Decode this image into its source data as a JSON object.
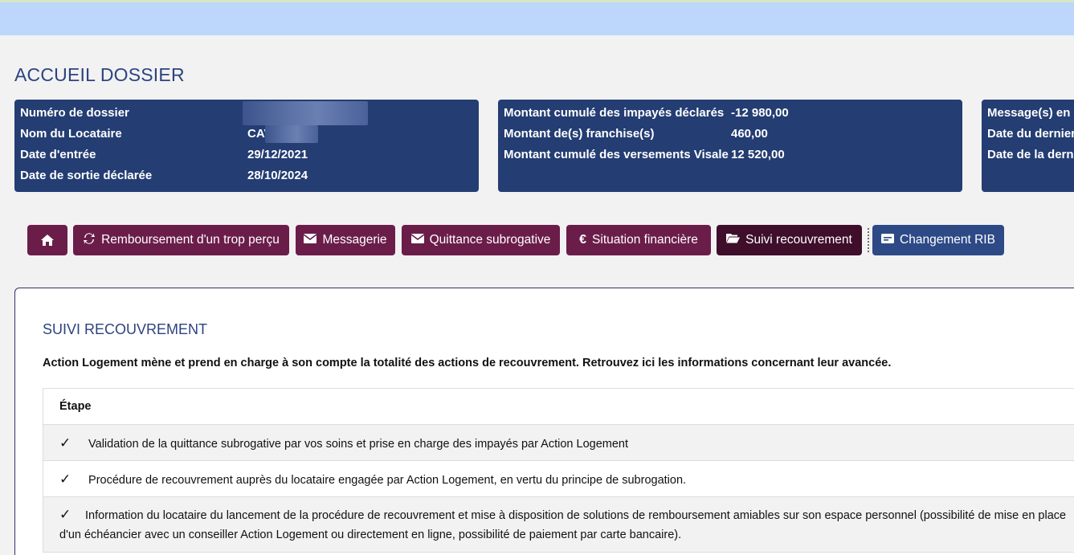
{
  "page": {
    "title": "ACCUEIL DOSSIER"
  },
  "dossier": {
    "rows": [
      {
        "label": "Numéro de dossier",
        "value": ""
      },
      {
        "label": "Nom du Locataire",
        "value": "CAV"
      },
      {
        "label": "Date d'entrée",
        "value": "29/12/2021"
      },
      {
        "label": "Date de sortie déclarée",
        "value": "28/10/2024"
      }
    ]
  },
  "montants": {
    "rows": [
      {
        "label": "Montant cumulé des impayés déclarés",
        "value": "-12 980,00"
      },
      {
        "label": "Montant de(s) franchise(s)",
        "value": "460,00"
      },
      {
        "label": "Montant cumulé des versements Visale",
        "value": "12 520,00"
      }
    ]
  },
  "messages": {
    "rows": [
      {
        "label": "Message(s) en a"
      },
      {
        "label": "Date du dernier"
      },
      {
        "label": "Date de la derni"
      }
    ]
  },
  "nav": {
    "home_icon": "home-icon",
    "buttons": [
      {
        "label": "Remboursement d'un trop perçu",
        "icon": "refresh-icon"
      },
      {
        "label": "Messagerie",
        "icon": "envelope-icon"
      },
      {
        "label": "Quittance subrogative",
        "icon": "envelope-icon"
      },
      {
        "label": "Situation financière",
        "icon": "euro-icon"
      },
      {
        "label": "Suivi recouvrement",
        "icon": "folder-open-icon"
      },
      {
        "label": "Changement RIB",
        "icon": "card-icon"
      }
    ],
    "active": "Suivi recouvrement"
  },
  "section": {
    "title": "SUIVI RECOUVREMENT",
    "intro": "Action Logement mène et prend en charge à son compte la totalité des actions de recouvrement. Retrouvez ici les informations concernant leur avancée.",
    "table_header": "Étape",
    "steps": [
      "Validation de la quittance subrogative par vos soins et prise en charge des impayés par Action Logement",
      "Procédure de recouvrement auprès du locataire engagée par Action Logement, en vertu du principe de subrogation.",
      "Information du locataire du lancement de la procédure de recouvrement et mise à disposition de solutions de remboursement amiables sur son espace personnel (possibilité de mise en place d'un échéancier avec un conseiller Action Logement ou directement en ligne, possibilité de paiement par carte bancaire)."
    ]
  },
  "colors": {
    "accent_blue": "#243d73",
    "nav_purple": "#6b1d4a",
    "nav_active": "#3e0e2b",
    "nav_blue": "#2d4a87"
  }
}
